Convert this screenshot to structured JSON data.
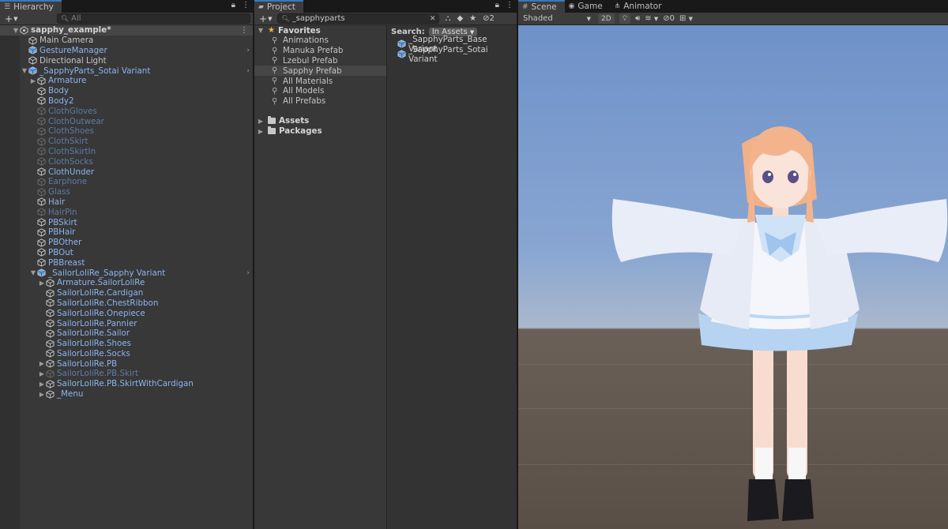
{
  "hierarchy": {
    "tab_label": "Hierarchy",
    "add_label": "+",
    "search_placeholder": "All",
    "rows": [
      {
        "label": "sapphy_example*",
        "indent": 0,
        "arrow": "▼",
        "icon": "scene",
        "style": "bold",
        "selected": true,
        "menu": true
      },
      {
        "label": "Main Camera",
        "indent": 1,
        "arrow": "",
        "icon": "cube-outline",
        "style": ""
      },
      {
        "label": "GestureManager",
        "indent": 1,
        "arrow": "",
        "icon": "cube-blue",
        "style": "blue",
        "chevron": true
      },
      {
        "label": "Directional Light",
        "indent": 1,
        "arrow": "",
        "icon": "cube-outline",
        "style": ""
      },
      {
        "label": "_SapphyParts_Sotai Variant",
        "indent": 1,
        "arrow": "▼",
        "icon": "cube-blue",
        "style": "blue",
        "chevron": true
      },
      {
        "label": "Armature",
        "indent": 2,
        "arrow": "▶",
        "icon": "cube-outline",
        "style": "blue"
      },
      {
        "label": "Body",
        "indent": 2,
        "arrow": "",
        "icon": "cube-outline",
        "style": "blue"
      },
      {
        "label": "Body2",
        "indent": 2,
        "arrow": "",
        "icon": "cube-outline",
        "style": "blue"
      },
      {
        "label": "ClothGloves",
        "indent": 2,
        "arrow": "",
        "icon": "cube-dim",
        "style": "dim"
      },
      {
        "label": "ClothOutwear",
        "indent": 2,
        "arrow": "",
        "icon": "cube-dim",
        "style": "dim"
      },
      {
        "label": "ClothShoes",
        "indent": 2,
        "arrow": "",
        "icon": "cube-dim",
        "style": "dim"
      },
      {
        "label": "ClothSkirt",
        "indent": 2,
        "arrow": "",
        "icon": "cube-dim",
        "style": "dim"
      },
      {
        "label": "ClothSkirtIn",
        "indent": 2,
        "arrow": "",
        "icon": "cube-dim",
        "style": "dim"
      },
      {
        "label": "ClothSocks",
        "indent": 2,
        "arrow": "",
        "icon": "cube-dim",
        "style": "dim"
      },
      {
        "label": "ClothUnder",
        "indent": 2,
        "arrow": "",
        "icon": "cube-outline",
        "style": "blue"
      },
      {
        "label": "Earphone",
        "indent": 2,
        "arrow": "",
        "icon": "cube-dim",
        "style": "dim"
      },
      {
        "label": "Glass",
        "indent": 2,
        "arrow": "",
        "icon": "cube-dim",
        "style": "dim"
      },
      {
        "label": "Hair",
        "indent": 2,
        "arrow": "",
        "icon": "cube-outline",
        "style": "blue"
      },
      {
        "label": "HairPin",
        "indent": 2,
        "arrow": "",
        "icon": "cube-dim",
        "style": "dim"
      },
      {
        "label": "PBSkirt",
        "indent": 2,
        "arrow": "",
        "icon": "cube-outline",
        "style": "blue"
      },
      {
        "label": "PBHair",
        "indent": 2,
        "arrow": "",
        "icon": "cube-outline",
        "style": "blue"
      },
      {
        "label": "PBOther",
        "indent": 2,
        "arrow": "",
        "icon": "cube-outline",
        "style": "blue"
      },
      {
        "label": "PBOut",
        "indent": 2,
        "arrow": "",
        "icon": "cube-outline",
        "style": "blue"
      },
      {
        "label": "PBBreast",
        "indent": 2,
        "arrow": "",
        "icon": "cube-outline",
        "style": "blue"
      },
      {
        "label": "_SailorLoliRe_Sapphy Variant",
        "indent": 2,
        "arrow": "▼",
        "icon": "cube-blue",
        "style": "blue",
        "chevron": true
      },
      {
        "label": "Armature.SailorLoliRe",
        "indent": 3,
        "arrow": "▶",
        "icon": "cube-outline",
        "style": "blue"
      },
      {
        "label": "SailorLoliRe.Cardigan",
        "indent": 3,
        "arrow": "",
        "icon": "cube-outline",
        "style": "blue"
      },
      {
        "label": "SailorLoliRe.ChestRibbon",
        "indent": 3,
        "arrow": "",
        "icon": "cube-outline",
        "style": "blue"
      },
      {
        "label": "SailorLoliRe.Onepiece",
        "indent": 3,
        "arrow": "",
        "icon": "cube-outline",
        "style": "blue"
      },
      {
        "label": "SailorLoliRe.Pannier",
        "indent": 3,
        "arrow": "",
        "icon": "cube-outline",
        "style": "blue"
      },
      {
        "label": "SailorLoliRe.Sailor",
        "indent": 3,
        "arrow": "",
        "icon": "cube-outline",
        "style": "blue"
      },
      {
        "label": "SailorLoliRe.Shoes",
        "indent": 3,
        "arrow": "",
        "icon": "cube-outline",
        "style": "blue"
      },
      {
        "label": "SailorLoliRe.Socks",
        "indent": 3,
        "arrow": "",
        "icon": "cube-outline",
        "style": "blue"
      },
      {
        "label": "SailorLoliRe.PB",
        "indent": 3,
        "arrow": "▶",
        "icon": "cube-outline",
        "style": "blue"
      },
      {
        "label": "SailorLoliRe.PB.Skirt",
        "indent": 3,
        "arrow": "▶",
        "icon": "cube-dim",
        "style": "dim"
      },
      {
        "label": "SailorLoliRe.PB.SkirtWithCardigan",
        "indent": 3,
        "arrow": "▶",
        "icon": "cube-outline",
        "style": "blue"
      },
      {
        "label": "_Menu",
        "indent": 3,
        "arrow": "▶",
        "icon": "cube-outline",
        "style": "blue"
      }
    ]
  },
  "project": {
    "tab_label": "Project",
    "add_label": "+",
    "search_value": "_sapphyparts",
    "hidden_count": "2",
    "favorites_label": "Favorites",
    "favorites": [
      {
        "label": "Animations",
        "selected": false
      },
      {
        "label": "Manuka Prefab",
        "selected": false
      },
      {
        "label": "Lzebul Prefab",
        "selected": false
      },
      {
        "label": "Sapphy Prefab",
        "selected": true
      },
      {
        "label": "All Materials",
        "selected": false
      },
      {
        "label": "All Models",
        "selected": false
      },
      {
        "label": "All Prefabs",
        "selected": false
      }
    ],
    "groups": [
      {
        "label": "Assets"
      },
      {
        "label": "Packages"
      }
    ],
    "search_label": "Search:",
    "scope_label": "In Assets",
    "results": [
      {
        "label": "_SapphyParts_Base Variant"
      },
      {
        "label": "_SapphyParts_Sotai Variant"
      }
    ]
  },
  "scene": {
    "tabs": [
      {
        "label": "Scene",
        "icon": "#",
        "active": true
      },
      {
        "label": "Game",
        "icon": "◉",
        "active": false
      },
      {
        "label": "Animator",
        "icon": "⋔",
        "active": false
      }
    ],
    "shading_mode": "Shaded",
    "mode_2d": "2D",
    "hidden_count": "0"
  },
  "colors": {
    "accent": "#3a79bb",
    "prefab_blue": "#8cb4ef",
    "disabled_blue": "#5f7aa3",
    "panel_bg": "#383838"
  }
}
